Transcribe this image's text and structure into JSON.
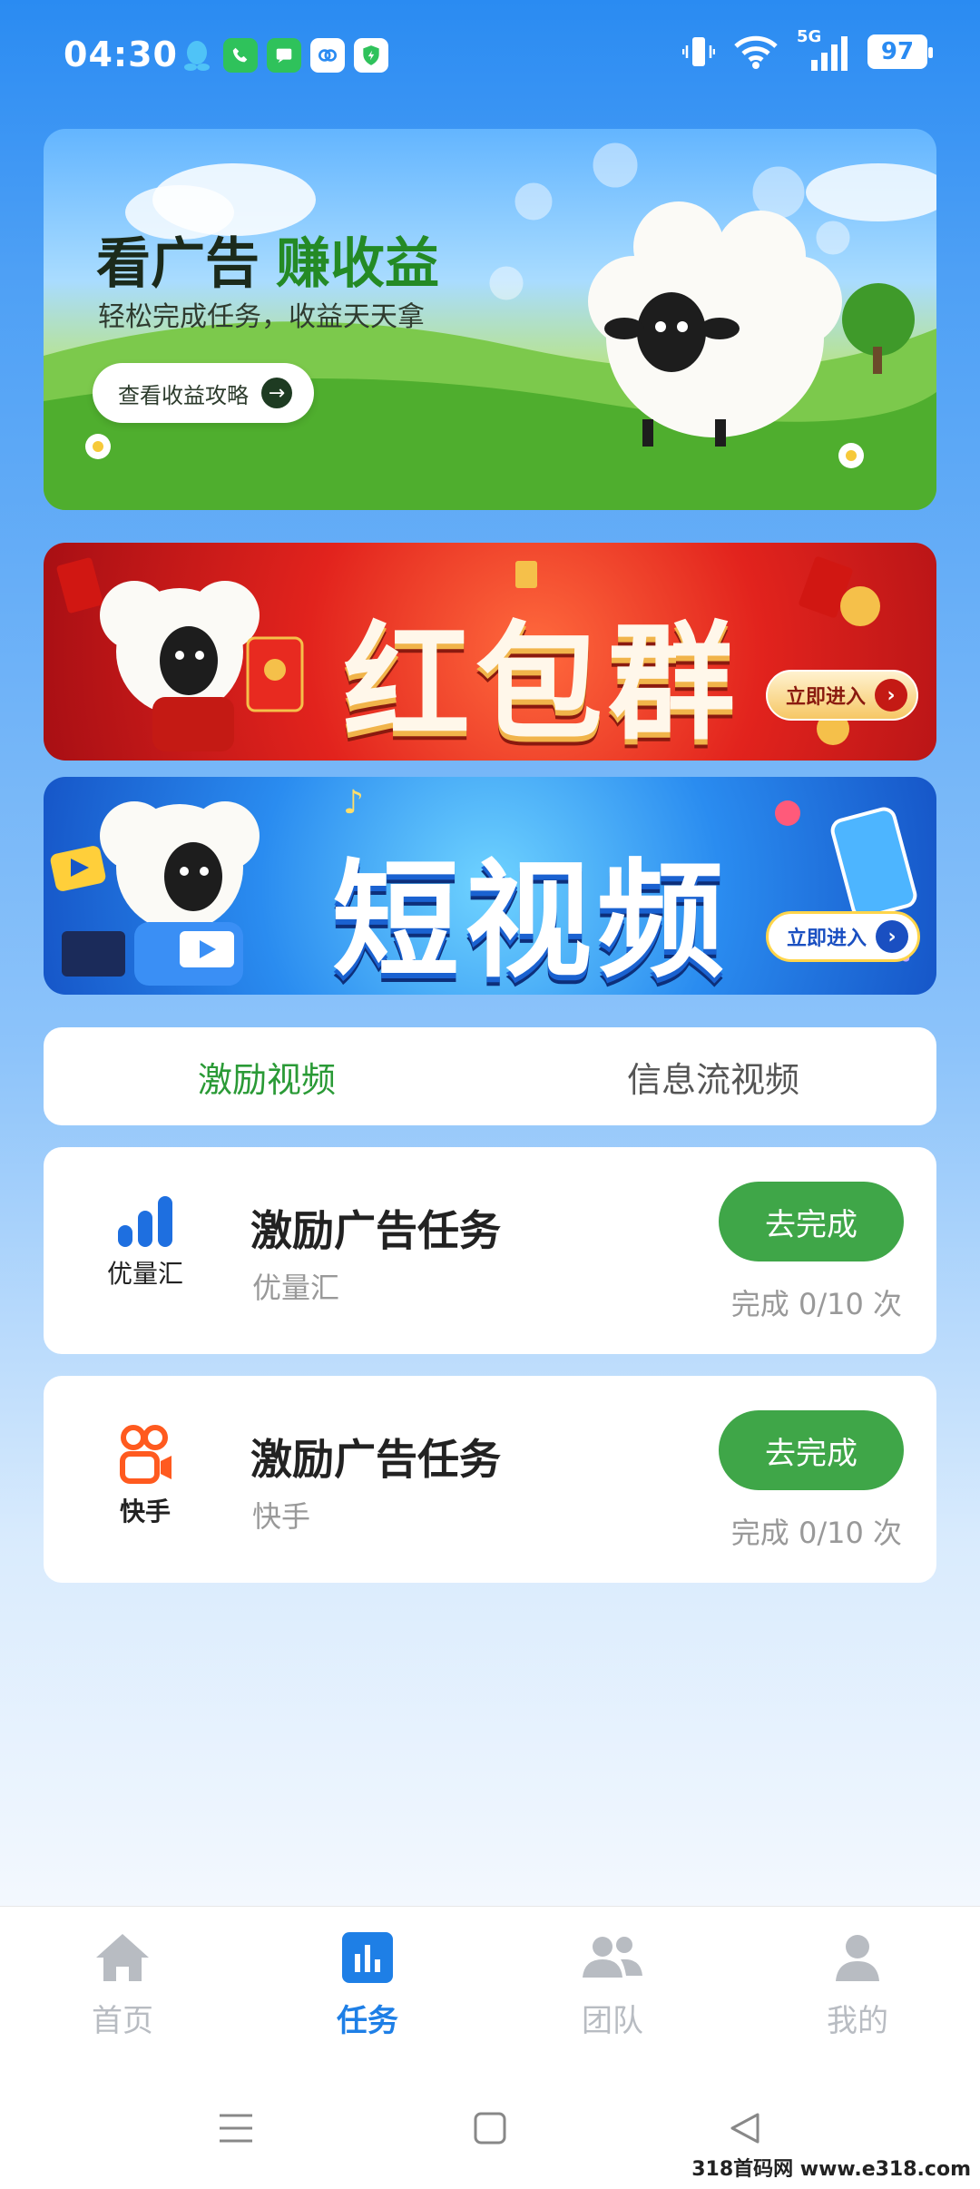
{
  "status_bar": {
    "time": "04:30",
    "battery": "97",
    "network": "5G"
  },
  "banners": {
    "earn": {
      "title": "看广告",
      "title_accent": "赚收益",
      "subtitle": "轻松完成任务，收益天天拿",
      "button": "查看收益攻略"
    },
    "red_packet": {
      "title": "红包群",
      "button": "立即进入"
    },
    "short_video": {
      "title": "短视频",
      "button": "立即进入"
    }
  },
  "tabs": [
    {
      "label": "激励视频",
      "active": true
    },
    {
      "label": "信息流视频",
      "active": false
    }
  ],
  "tasks": [
    {
      "logo_name": "优量汇",
      "title": "激励广告任务",
      "source": "优量汇",
      "button": "去完成",
      "progress": "完成 0/10 次"
    },
    {
      "logo_name": "快手",
      "title": "激励广告任务",
      "source": "快手",
      "button": "去完成",
      "progress": "完成 0/10 次"
    }
  ],
  "bottom_nav": [
    {
      "label": "首页",
      "icon": "home-icon",
      "active": false
    },
    {
      "label": "任务",
      "icon": "chart-icon",
      "active": true
    },
    {
      "label": "团队",
      "icon": "team-icon",
      "active": false
    },
    {
      "label": "我的",
      "icon": "user-icon",
      "active": false
    }
  ],
  "watermark": "318首码网 www.e318.com",
  "colors": {
    "primary": "#1e7fe6",
    "green": "#3fa648",
    "tab_active": "#2a9a36"
  }
}
